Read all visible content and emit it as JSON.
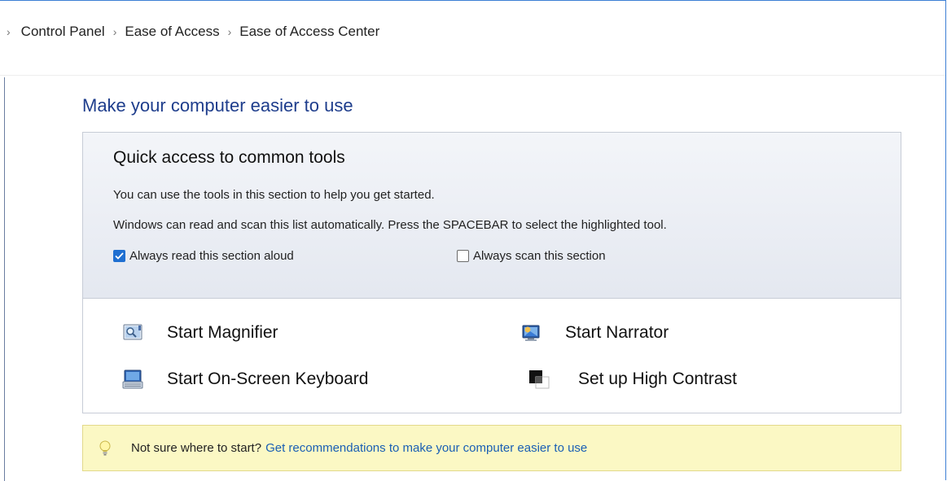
{
  "breadcrumb": {
    "items": [
      "Control Panel",
      "Ease of Access",
      "Ease of Access Center"
    ]
  },
  "page_title": "Make your computer easier to use",
  "quick_access": {
    "title": "Quick access to common tools",
    "description1": "You can use the tools in this section to help you get started.",
    "description2": "Windows can read and scan this list automatically.  Press the SPACEBAR to select the highlighted tool.",
    "read_aloud": {
      "label": "Always read this section aloud",
      "checked": true
    },
    "scan": {
      "label": "Always scan this section",
      "checked": false
    },
    "tools": {
      "magnifier": {
        "label": "Start Magnifier",
        "icon": "magnifier-icon"
      },
      "narrator": {
        "label": "Start Narrator",
        "icon": "narrator-icon"
      },
      "keyboard": {
        "label": "Start On-Screen Keyboard",
        "icon": "keyboard-icon"
      },
      "contrast": {
        "label": "Set up High Contrast",
        "icon": "high-contrast-icon"
      }
    }
  },
  "tip": {
    "text": "Not sure where to start?",
    "link": "Get recommendations to make your computer easier to use",
    "icon": "lightbulb-icon"
  },
  "colors": {
    "title_blue": "#1e3d8c",
    "link_blue": "#1a5fb4",
    "checkbox_blue": "#1f6fd1",
    "tip_background": "#fbf8c4"
  }
}
